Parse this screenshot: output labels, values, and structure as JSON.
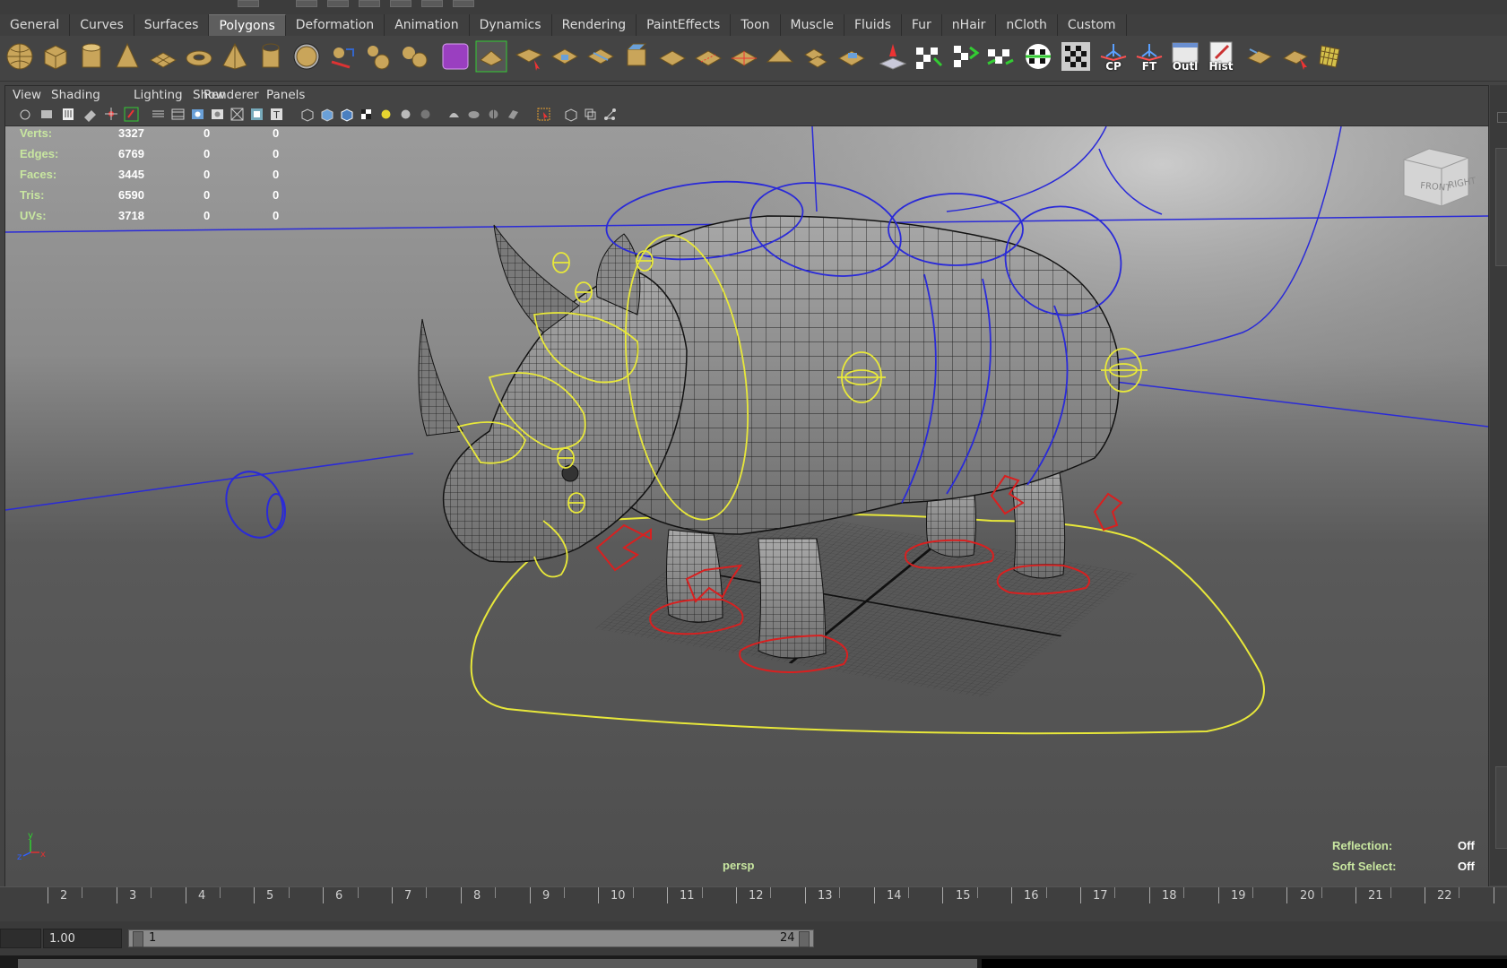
{
  "shelf_tabs": [
    "General",
    "Curves",
    "Surfaces",
    "Polygons",
    "Deformation",
    "Animation",
    "Dynamics",
    "Rendering",
    "PaintEffects",
    "Toon",
    "Muscle",
    "Fluids",
    "Fur",
    "nHair",
    "nCloth",
    "Custom"
  ],
  "active_tab": "Polygons",
  "shelf_labels": {
    "cp": "CP",
    "ft": "FT",
    "outliner": "Outl",
    "history": "Hist"
  },
  "panel_menu": [
    "View",
    "Shading",
    "Lighting",
    "Show",
    "Renderer",
    "Panels"
  ],
  "hud": {
    "rows": [
      {
        "label": "Verts:",
        "v1": "3327",
        "v2": "0",
        "v3": "0"
      },
      {
        "label": "Edges:",
        "v1": "6769",
        "v2": "0",
        "v3": "0"
      },
      {
        "label": "Faces:",
        "v1": "3445",
        "v2": "0",
        "v3": "0"
      },
      {
        "label": "Tris:",
        "v1": "6590",
        "v2": "0",
        "v3": "0"
      },
      {
        "label": "UVs:",
        "v1": "3718",
        "v2": "0",
        "v3": "0"
      }
    ],
    "camera": "persp",
    "reflection_label": "Reflection:",
    "reflection_value": "Off",
    "soft_select_label": "Soft Select:",
    "soft_select_value": "Off"
  },
  "viewcube": {
    "front": "FRONT",
    "right": "RIGHT"
  },
  "axis": {
    "x": "x",
    "y": "y",
    "z": "z"
  },
  "timeline": {
    "labels": [
      "2",
      "3",
      "4",
      "5",
      "6",
      "7",
      "8",
      "9",
      "10",
      "11",
      "12",
      "13",
      "14",
      "15",
      "16",
      "17",
      "18",
      "19",
      "20",
      "21",
      "22"
    ]
  },
  "range": {
    "start_time": "1.00",
    "range_start": "1",
    "range_end": "24"
  },
  "colors": {
    "nurbs_curve": "#e8e83a",
    "blue_curve": "#2a2ad8",
    "red_handle": "#d82020",
    "mesh_fill": "#8e8e8e",
    "wire": "#1e1e1e"
  }
}
